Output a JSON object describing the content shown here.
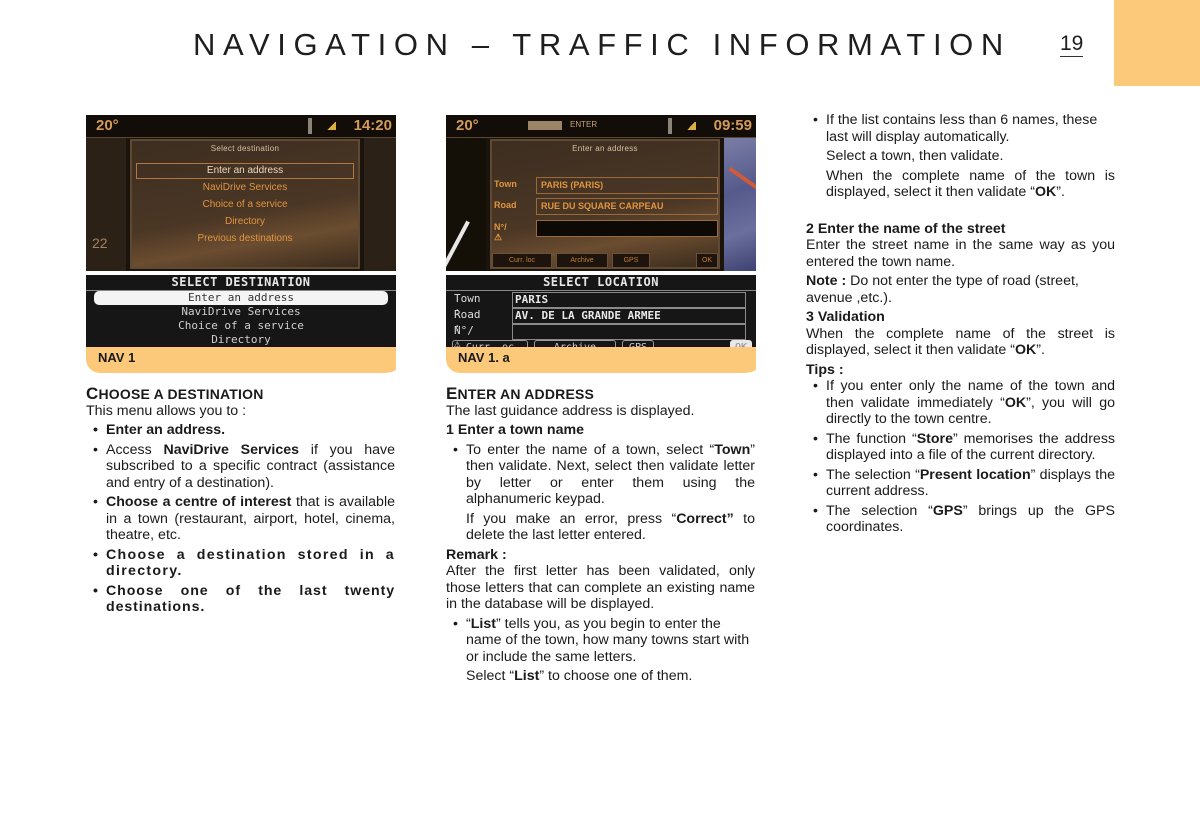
{
  "header": {
    "title": "NAVIGATION – TRAFFIC INFORMATION",
    "page_number": "19"
  },
  "screens": {
    "nav1": {
      "caption": "NAV 1",
      "color_display": {
        "temperature": "20°",
        "clock": "14:20",
        "side_number": "22",
        "dialog_title": "Select destination",
        "items": [
          "Enter an address",
          "NaviDrive Services",
          "Choice of a service",
          "Directory",
          "Previous destinations"
        ],
        "selected_index": 0
      },
      "mono_display": {
        "title": "SELECT DESTINATION",
        "items": [
          "Enter an address",
          "NaviDrive Services",
          "Choice of a service",
          "Directory",
          "Previous destinations"
        ],
        "selected_index": 0
      }
    },
    "nav1a": {
      "caption": "NAV 1. a",
      "color_display": {
        "temperature": "20°",
        "clock": "09:59",
        "status_label": "ENTER",
        "dialog_title": "Enter an address",
        "fields": [
          {
            "label": "Town",
            "value": "PARIS (PARIS)"
          },
          {
            "label": "Road",
            "value": "RUE DU SQUARE CARPEAU"
          },
          {
            "label": "N°/⚠",
            "value": ""
          }
        ],
        "softkeys": [
          "Curr. loc",
          "Archive",
          "GPS",
          "OK"
        ]
      },
      "mono_display": {
        "title": "SELECT LOCATION",
        "fields": [
          {
            "label": "Town :",
            "value": "PARIS"
          },
          {
            "label": "Road :",
            "value": "AV. DE LA GRANDE ARMEE"
          },
          {
            "label": "N°/⚠",
            "value": ""
          }
        ],
        "softkeys": [
          "Curr. oc",
          "Archive",
          "GPS",
          "OK"
        ]
      }
    }
  },
  "col1": {
    "heading_first": "C",
    "heading_rest": "HOOSE A DESTINATION",
    "intro": "This menu allows you to :",
    "b1": "Enter an address.",
    "b2_pre": "Access ",
    "b2_bold": "NaviDrive Services",
    "b2_post": " if you have subscribed to a specific contract (assistance and entry of a destination).",
    "b3_bold": "Choose a centre of interest",
    "b3_post": " that is available in a town (restaurant, airport, hotel, cinema, theatre, etc.",
    "b4": "Choose a destination stored in a directory.",
    "b5": "Choose one of the last twenty destinations."
  },
  "col2": {
    "heading_first": "E",
    "heading_rest": "NTER AN ADDRESS",
    "intro": "The last guidance address is displayed.",
    "step1": "1 Enter a town name",
    "s1_pre": "To enter the name of a town, select “",
    "s1_bold": "Town",
    "s1_post": "” then validate. Next, select then validate letter by letter or enter them using the alphanumeric keypad.",
    "s1_cont_pre": "If you make an error, press “",
    "s1_cont_bold": "Correct”",
    "s1_cont_post": " to delete the last letter entered.",
    "remark_label": "Remark :",
    "remark": "After the first letter has been validated, only those letters that can complete an existing name in the database will be displayed.",
    "list_pre": "“",
    "list_bold": "List",
    "list_post": "” tells you, as you begin to enter the name of the town, how many towns start with or include the same letters.",
    "list_cont_pre": "Select “",
    "list_cont_bold": "List",
    "list_cont_post": "” to choose one of them."
  },
  "col3": {
    "b1": "If the list contains less than 6 names, these last will display automatically.",
    "b1_c1": "Select a town, then validate.",
    "b1_c2_pre": "When the complete name of the town is displayed, select it then validate “",
    "b1_c2_bold": "OK",
    "b1_c2_post": "”.",
    "step2": "2 Enter the name of the street",
    "step2_text": "Enter the street name in the same way as you entered the town name.",
    "note_label": "Note :",
    "note": " Do not enter the type of road (street, avenue ,etc.).",
    "step3": "3 Validation",
    "step3_pre": "When the complete name of the street is displayed, select it then validate “",
    "step3_bold": "OK",
    "step3_post": "”.",
    "tips_label": "Tips :",
    "t1_pre": "If you enter only the name of the town and then validate immediately “",
    "t1_bold": "OK",
    "t1_post": "”, you will go directly to the town centre.",
    "t2_pre": "The function “",
    "t2_bold": "Store",
    "t2_post": "” memorises the address displayed into a file of the current directory.",
    "t3_pre": "The selection “",
    "t3_bold": "Present location",
    "t3_post": "” displays the current address.",
    "t4_pre": "The selection “",
    "t4_bold": "GPS",
    "t4_post": "” brings up the GPS coordinates."
  }
}
